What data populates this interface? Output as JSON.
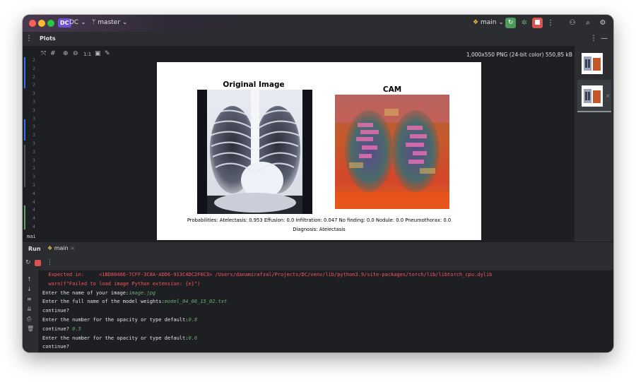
{
  "titlebar": {
    "project_badge": "DC",
    "project_name": "DC",
    "branch": "master",
    "run_config": "main"
  },
  "toolwindow": {
    "title": "Plots"
  },
  "plot_viewer": {
    "zoom_actual": "1:1",
    "image_info": "1,000x550 PNG (24-bit color) 550,85 kB",
    "figure": {
      "left_title": "Original Image",
      "right_title": "CAM",
      "probabilities": "Probabilities: Atelectasis: 0.953 Effusion: 0.0 Infiltration: 0.047 No finding: 0.0 Nodule: 0.0 Pneumothorax: 0.0",
      "diagnosis": "Diagnosis: Atelectasis"
    }
  },
  "gutter": {
    "numbers": [
      "2",
      "2",
      "2",
      "2",
      "3",
      "3",
      "3",
      "3",
      "3",
      "3",
      "3",
      "3",
      "3",
      "3",
      "3",
      "3",
      "4",
      "4",
      "4",
      "4",
      "4"
    ],
    "bottom_label": "mai"
  },
  "run_panel": {
    "tab_label": "Run",
    "config_tab": "main"
  },
  "console": {
    "lines": [
      {
        "text": "  Expected in:     <1BD80466-7CFF-3C8A-ADD6-913C4DC2F6C3> /Users/danamirafzal/Projects/DC/venv/lib/python3.9/site-packages/torch/lib/libtorch_cpu.dylib",
        "kind": "error"
      },
      {
        "text": "  warn(f\"Failed to load image Python extension: {e}\")",
        "kind": "error"
      },
      {
        "prompt": "Enter the name of your image:",
        "input": "image.jpg"
      },
      {
        "prompt": "Enter the full name of the model weights:",
        "input": "model_04_06_15_02.txt"
      },
      {
        "prompt": "continue?",
        "input": ""
      },
      {
        "prompt": "Enter the number for the opacity or type default:",
        "input": "0.8"
      },
      {
        "prompt": "continue? ",
        "input": "0.5"
      },
      {
        "prompt": "Enter the number for the opacity or type default:",
        "input": "0.6"
      },
      {
        "prompt": "continue?",
        "input": ""
      }
    ]
  },
  "colors": {
    "accent_badge": "#6e4fd8",
    "run_green": "#4e9a5a",
    "stop_red": "#d9534f",
    "error_text": "#f75464",
    "input_text": "#6aab73"
  }
}
